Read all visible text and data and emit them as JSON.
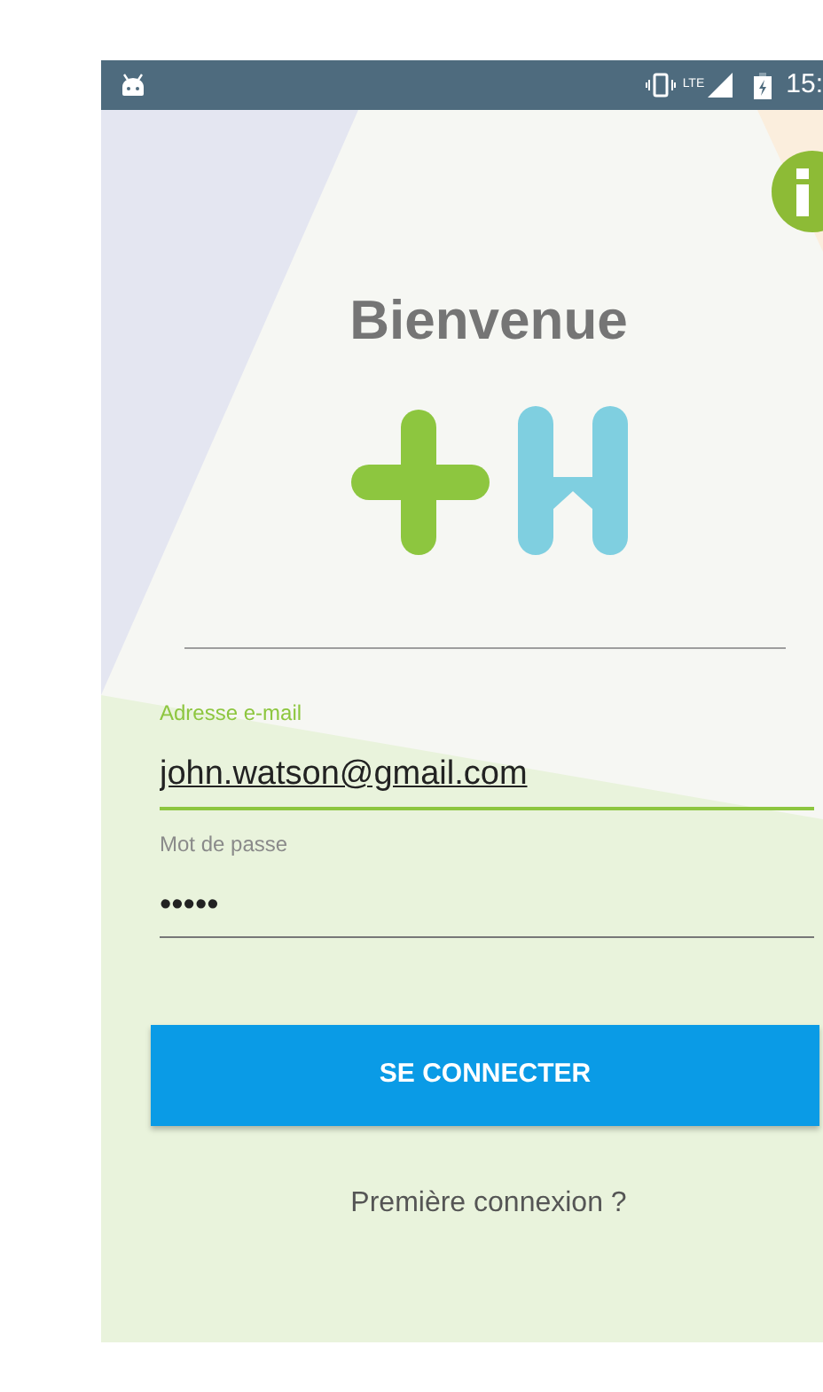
{
  "status_bar": {
    "network": "LTE",
    "time": "15:"
  },
  "title": "Bienvenue",
  "fields": [
    {
      "label": "Adresse e-mail",
      "value": "john.watson@gmail.com",
      "focused": true
    },
    {
      "label": "Mot de passe",
      "value": "•••••",
      "focused": false
    }
  ],
  "login_button": "SE CONNECTER",
  "first_login_link": "Première connexion ?"
}
